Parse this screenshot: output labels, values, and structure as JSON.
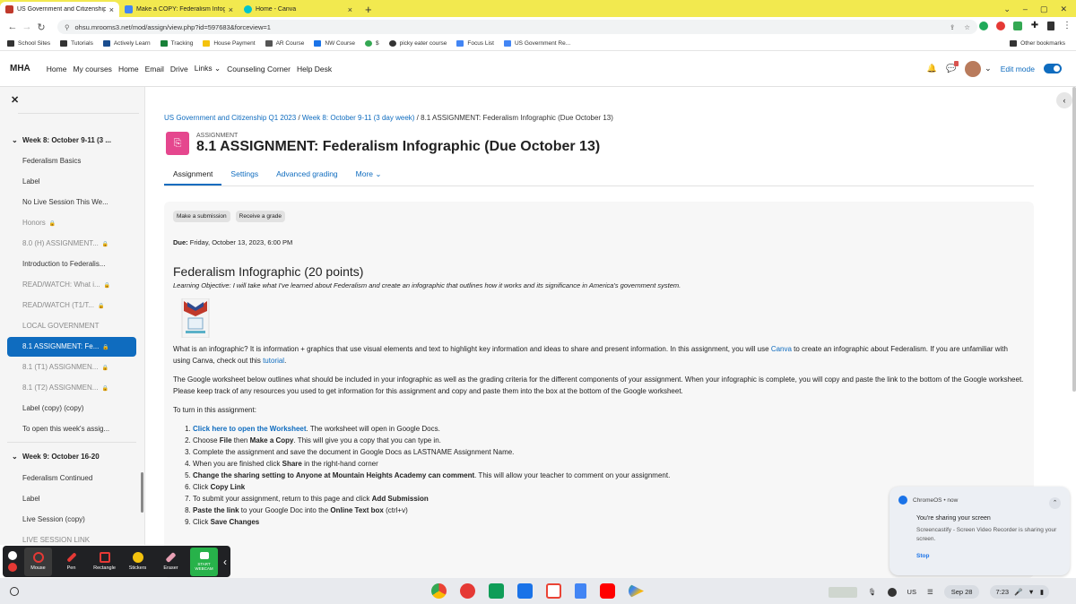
{
  "browser": {
    "tabs": [
      {
        "title": "US Government and Citizenship",
        "favicon_color": "#c0392b",
        "active": true
      },
      {
        "title": "Make a COPY: Federalism Infog",
        "favicon_color": "#4285f4",
        "active": false
      },
      {
        "title": "Home - Canva",
        "favicon_color": "#00c4cc",
        "active": false
      }
    ],
    "new_tab": "+",
    "url": "ohsu.mrooms3.net/mod/assign/view.php?id=597683&forceview=1",
    "bookmarks": [
      "School Sites",
      "Tutorials",
      "Actively Learn",
      "Tracking",
      "House Payment",
      "AR Course",
      "NW Course",
      "$",
      "picky eater course",
      "Focus List",
      "US Government Re..."
    ],
    "other_bookmarks": "Other bookmarks"
  },
  "moodle_nav": {
    "brand": "MHA",
    "items": [
      "Home",
      "My courses",
      "Home",
      "Email",
      "Drive",
      "Links",
      "Counseling Corner",
      "Help Desk"
    ],
    "edit_mode_label": "Edit mode"
  },
  "sidebar": {
    "items": [
      {
        "label": "Week 8: October 9-11 (3 ...",
        "type": "section"
      },
      {
        "label": "Federalism Basics",
        "type": "item"
      },
      {
        "label": "Label",
        "type": "item"
      },
      {
        "label": "No Live Session This We...",
        "type": "item"
      },
      {
        "label": "Honors",
        "type": "dim",
        "lock": true
      },
      {
        "label": "8.0 (H) ASSIGNMENT...",
        "type": "dim",
        "lock": true
      },
      {
        "label": "Introduction to Federalis...",
        "type": "item"
      },
      {
        "label": "READ/WATCH: What i...",
        "type": "dim",
        "lock": true
      },
      {
        "label": "READ/WATCH (T1/T...",
        "type": "dim",
        "lock": true
      },
      {
        "label": "LOCAL GOVERNMENT",
        "type": "dim"
      },
      {
        "label": "8.1 ASSIGNMENT: Fe...",
        "type": "active",
        "lock": true
      },
      {
        "label": "8.1 (T1) ASSIGNMEN...",
        "type": "dim",
        "lock": true
      },
      {
        "label": "8.1 (T2) ASSIGNMEN...",
        "type": "dim",
        "lock": true
      },
      {
        "label": "Label (copy) (copy)",
        "type": "item"
      },
      {
        "label": "To open this week's assig...",
        "type": "item"
      },
      {
        "label": "Week 9: October 16-20",
        "type": "section"
      },
      {
        "label": "Federalism Continued",
        "type": "item"
      },
      {
        "label": "Label",
        "type": "item"
      },
      {
        "label": "Live Session (copy)",
        "type": "item"
      },
      {
        "label": "LIVE SESSION LINK",
        "type": "dim"
      }
    ]
  },
  "breadcrumb": {
    "course": "US Government and Citizenship Q1 2023",
    "week": "Week 8: October 9-11 (3 day week)",
    "current": "8.1 ASSIGNMENT: Federalism Infographic (Due October 13)"
  },
  "page": {
    "kicker": "ASSIGNMENT",
    "title": "8.1 ASSIGNMENT: Federalism Infographic (Due October 13)"
  },
  "tabs": [
    "Assignment",
    "Settings",
    "Advanced grading",
    "More"
  ],
  "actions": {
    "make_submission": "Make a submission",
    "receive_grade": "Receive a grade"
  },
  "due": {
    "label": "Due:",
    "value": "Friday, October 13, 2023, 6:00 PM"
  },
  "content": {
    "heading": "Federalism Infographic (20 points)",
    "objective": "Learning Objective: I will take what I've learned about Federalism and create an infographic that outlines how it works and its significance in America's government system.",
    "p1_a": "What is an infographic? It is information + graphics that use visual elements and text to highlight key information and ideas to share and present information. In this assignment, you will use ",
    "p1_link": "Canva",
    "p1_b": " to create an infographic about Federalism. If you are unfamiliar with using Canva, check out this ",
    "p1_link2": "tutorial",
    "p1_c": ".",
    "p2": "The Google worksheet below outlines what should be included in your infographic as well as the grading criteria for the different components of your assignment. When your infographic is complete, you will copy and paste the link to the bottom of the Google worksheet. Please keep track of any resources you used to get information for this assignment and copy and paste them into the box at the bottom of the Google worksheet.",
    "p3": "To turn in this assignment:",
    "steps": {
      "s1_link": "Click here to open the Worksheet",
      "s1_rest": ". The worksheet will open in Google Docs.",
      "s2_a": "Choose ",
      "s2_b": "File",
      "s2_c": " then ",
      "s2_d": "Make a Copy",
      "s2_e": ". This will give you a copy that you can type in.",
      "s3": "Complete the assignment and save the document in Google Docs as LASTNAME Assignment Name.",
      "s4_a": "When you are finished click ",
      "s4_b": "Share",
      "s4_c": " in the right-hand corner",
      "s5_a": "Change the sharing setting to Anyone at Mountain Heights Academy can comment",
      "s5_b": ". This will allow your teacher to comment on your assignment.",
      "s6_a": "Click ",
      "s6_b": "Copy Link",
      "s7_a": "To submit your assignment, return to this page and click ",
      "s7_b": "Add Submission",
      "s8_a": "Paste the link",
      "s8_b": " to your Google Doc into the ",
      "s8_c": "Online Text box",
      "s8_d": " (ctrl+v)",
      "s9_a": "Click ",
      "s9_b": "Save Changes"
    }
  },
  "screencastify": {
    "tools": [
      "Mouse",
      "Pen",
      "Rectangle",
      "Stickers",
      "Eraser",
      "START WEBCAM"
    ]
  },
  "notification": {
    "source": "ChromeOS • now",
    "title": "You're sharing your screen",
    "body": "Screencastify - Screen Video Recorder is sharing your screen.",
    "action": "Stop"
  },
  "shelf": {
    "keyboard": "US",
    "date": "Sep 28",
    "time": "7:23"
  }
}
